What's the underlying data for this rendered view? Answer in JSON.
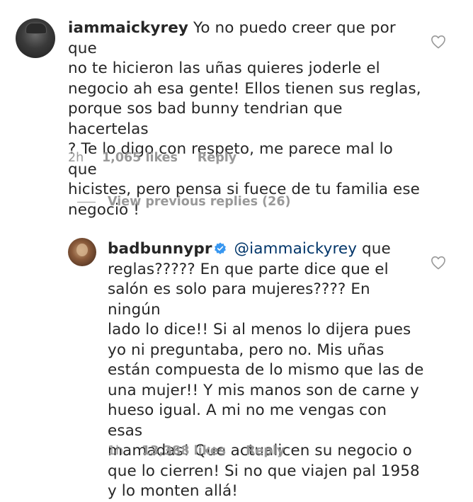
{
  "comments": [
    {
      "username": "iammaickyrey",
      "text": "Yo no puedo creer que por que\nno te hicieron las uñas quieres joderle el\nnegocio ah esa gente! Ellos tienen sus reglas,\nporque sos bad bunny tendrian que hacertelas\n? Te lo digo con respeto, me parece mal lo que\nhicistes, pero pensa si fuece de tu familia ese\nnegocio !",
      "time": "2h",
      "likes": "1,065 likes",
      "reply_label": "Reply"
    },
    {
      "username": "badbunnypr",
      "verified": true,
      "mention": "@iammaickyrey",
      "text": " que\nreglas????? En que parte dice que el\nsalón es solo para mujeres???? En ningún\nlado lo dice!! Si al menos lo dijera pues\nyo ni preguntaba, pero no. Mis uñas\nestán compuesta de lo mismo que las de\nuna mujer!! Y mis manos son de carne y\nhueso igual. A mi no me vengas con esas\nmamadas! Que actualicen su negocio o\nque lo cierren! Si no que viajen pal 1958\ny lo monten allá!",
      "time": "1h",
      "likes": "13,388 likes",
      "reply_label": "Reply"
    }
  ],
  "view_replies": "View previous replies (26)",
  "colors": {
    "text": "#262626",
    "muted": "#999999",
    "mention": "#003569",
    "verified": "#3897f0"
  }
}
